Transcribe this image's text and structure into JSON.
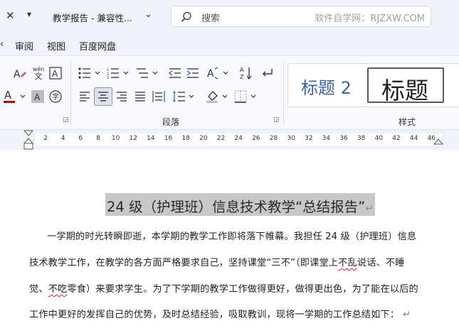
{
  "titlebar": {
    "close": "✕",
    "menu": "▾",
    "doc_title": "教学报告 - 兼容性...",
    "chevron": "⌄",
    "search_placeholder": "搜索",
    "watermark": "软件自学网：RJZXW.COM"
  },
  "menu": {
    "items": [
      "审阅",
      "视图",
      "百度网盘"
    ]
  },
  "ribbon": {
    "font_ruby_top": "wén",
    "font_ruby_bottom": "文",
    "paragraph_label": "段落",
    "styles_label": "样式",
    "style_heading2": "标题 2",
    "style_title": "标题"
  },
  "ruler": {
    "ticks": [
      "2",
      "4",
      "6",
      "8",
      "10",
      "12",
      "14",
      "16",
      "18",
      "20",
      "22",
      "24",
      "26",
      "28",
      "30",
      "32",
      "34",
      "36",
      "38",
      "40",
      "42",
      "44",
      "46"
    ]
  },
  "document": {
    "title": "24 级（护理班）信息技术教学“总结报告”",
    "line1": "一学期的时光转瞬即逝，本学期的教学工作即将落下帷幕。我担任 24 级（护理班）信息",
    "line2_a": "技术教学工作，在教学的各方面严格要求自己，坚持课堂“三不”（即课堂上",
    "line2_b": "不乱",
    "line2_c": "说话、不睡",
    "line3_a": "觉、",
    "line3_b": "不吃",
    "line3_c": "零食）来要求学生。为了下学期的教学工作做得更好，做得更出色，为了能在以后的",
    "line4": "工作中更好的发挥自己的优势，及时总结经验，吸取教训，现将一学期的工作总结如下："
  },
  "colors": {
    "chrome": "#eef3fa",
    "ribbon": "#f7f9fc",
    "heading_blue": "#3c66a8",
    "highlight_gray": "#c8c8c8"
  }
}
